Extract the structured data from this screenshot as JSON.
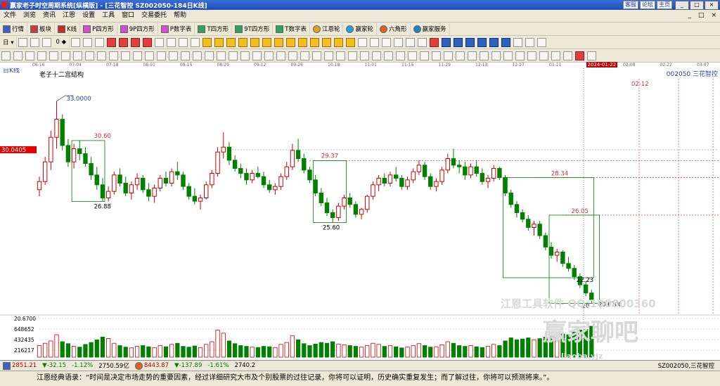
{
  "window": {
    "title": "赢家老子时空周期系统[纵横版] - [三花智控   SZ002050-184日K线]",
    "links": [
      "客服",
      "论坛",
      "主页"
    ],
    "controls": [
      "_",
      "□",
      "×"
    ],
    "mdi_controls": [
      "_",
      "□",
      "×"
    ]
  },
  "menu": [
    "文件",
    "浏览",
    "资讯",
    "江恩",
    "设置",
    "工具",
    "窗口",
    "交易委托",
    "帮助"
  ],
  "toolbar1": [
    "行情",
    "板块",
    "K线",
    "P四方形",
    "9P四方形",
    "P数字表",
    "T四方形",
    "9T四方形",
    "T数字表",
    "江恩轮",
    "赢家轮",
    "六角形",
    "赢家服务"
  ],
  "toolbar2_zoom": "0",
  "chart_data": {
    "type": "candlestick",
    "title": "日K线",
    "label": "老子十二宫结构",
    "security": "002050 三花智控",
    "date_ticks": [
      "06-16",
      "07-04",
      "07-18",
      "08-01",
      "08-15",
      "08-29",
      "09-12",
      "09-26",
      "10-18",
      "11-01",
      "11-15",
      "11-29",
      "12-13",
      "12-27",
      "01-11",
      "2024-01-22",
      "02-08",
      "02-22",
      "03-07"
    ],
    "selected_date": "2024-01-22",
    "projection_date": "02-12",
    "price_range": [
      20.67,
      33.0
    ],
    "current_price_tag": "30.0405",
    "annotations": [
      "33.0000",
      "30.60",
      "26.88",
      "29.37",
      "25.60",
      "28.34",
      "26.05",
      "22.23",
      "20.6700",
      "20"
    ],
    "volume_axis": [
      "20.6700",
      "648652",
      "432435",
      "216217"
    ],
    "candles": [
      [
        27.6,
        28.4,
        27.2,
        28.1
      ],
      [
        28.1,
        29.6,
        27.9,
        29.3
      ],
      [
        29.3,
        31.2,
        28.8,
        30.8
      ],
      [
        30.8,
        33.0,
        30.1,
        31.9
      ],
      [
        31.9,
        32.2,
        30.0,
        30.3
      ],
      [
        30.3,
        30.7,
        29.0,
        29.3
      ],
      [
        29.3,
        30.4,
        28.9,
        30.1
      ],
      [
        30.1,
        30.6,
        29.4,
        29.8
      ],
      [
        29.8,
        30.2,
        29.0,
        29.2
      ],
      [
        29.2,
        29.6,
        28.2,
        28.5
      ],
      [
        28.5,
        29.0,
        27.6,
        27.9
      ],
      [
        27.9,
        28.3,
        26.9,
        27.1
      ],
      [
        27.1,
        27.8,
        26.88,
        27.5
      ],
      [
        27.5,
        28.7,
        27.3,
        28.5
      ],
      [
        28.5,
        28.9,
        27.8,
        28.0
      ],
      [
        28.0,
        28.4,
        27.2,
        27.4
      ],
      [
        27.4,
        28.1,
        27.0,
        27.9
      ],
      [
        27.9,
        28.6,
        27.6,
        28.3
      ],
      [
        28.3,
        28.5,
        27.4,
        27.6
      ],
      [
        27.6,
        28.0,
        26.9,
        27.2
      ],
      [
        27.2,
        27.9,
        26.8,
        27.7
      ],
      [
        27.7,
        28.5,
        27.5,
        28.3
      ],
      [
        28.3,
        28.7,
        27.8,
        28.0
      ],
      [
        28.0,
        28.9,
        27.8,
        28.7
      ],
      [
        28.7,
        29.3,
        28.2,
        28.5
      ],
      [
        28.5,
        28.7,
        27.6,
        27.8
      ],
      [
        27.8,
        28.0,
        27.0,
        27.2
      ],
      [
        27.2,
        27.7,
        26.7,
        26.9
      ],
      [
        26.9,
        27.3,
        26.4,
        27.1
      ],
      [
        27.1,
        28.1,
        27.0,
        27.9
      ],
      [
        27.9,
        28.8,
        27.7,
        28.6
      ],
      [
        28.6,
        30.2,
        28.4,
        29.9
      ],
      [
        29.9,
        31.1,
        29.5,
        30.2
      ],
      [
        30.2,
        30.5,
        29.1,
        29.4
      ],
      [
        29.4,
        29.7,
        28.7,
        28.9
      ],
      [
        28.9,
        29.2,
        28.3,
        28.6
      ],
      [
        28.6,
        28.9,
        27.9,
        28.2
      ],
      [
        28.2,
        28.8,
        28.0,
        28.6
      ],
      [
        28.6,
        29.0,
        28.3,
        28.4
      ],
      [
        28.4,
        28.7,
        27.7,
        27.9
      ],
      [
        27.9,
        28.2,
        27.4,
        27.6
      ],
      [
        27.6,
        28.0,
        27.3,
        27.8
      ],
      [
        27.8,
        28.6,
        27.6,
        28.4
      ],
      [
        28.4,
        29.3,
        28.2,
        29.0
      ],
      [
        29.0,
        30.4,
        28.8,
        30.0
      ],
      [
        30.0,
        30.7,
        29.3,
        29.5
      ],
      [
        29.5,
        29.8,
        28.6,
        28.8
      ],
      [
        28.8,
        29.0,
        28.0,
        28.2
      ],
      [
        28.2,
        28.5,
        27.2,
        27.4
      ],
      [
        27.4,
        27.7,
        26.6,
        26.8
      ],
      [
        26.8,
        27.1,
        26.0,
        26.2
      ],
      [
        26.2,
        26.4,
        25.6,
        25.9
      ],
      [
        25.9,
        26.8,
        25.7,
        26.6
      ],
      [
        26.6,
        27.3,
        26.4,
        27.1
      ],
      [
        27.1,
        27.4,
        26.5,
        26.7
      ],
      [
        26.7,
        26.9,
        25.9,
        26.1
      ],
      [
        26.1,
        26.5,
        25.8,
        26.4
      ],
      [
        26.4,
        27.3,
        26.2,
        27.2
      ],
      [
        27.2,
        28.1,
        27.0,
        27.9
      ],
      [
        27.9,
        28.5,
        27.5,
        28.3
      ],
      [
        28.3,
        28.6,
        27.8,
        28.0
      ],
      [
        28.0,
        28.7,
        27.8,
        28.5
      ],
      [
        28.5,
        29.0,
        28.1,
        28.3
      ],
      [
        28.3,
        28.5,
        27.6,
        27.8
      ],
      [
        27.8,
        28.4,
        27.6,
        28.2
      ],
      [
        28.2,
        28.9,
        28.0,
        28.7
      ],
      [
        28.7,
        29.4,
        28.5,
        29.1
      ],
      [
        29.1,
        29.3,
        28.2,
        28.4
      ],
      [
        28.4,
        28.6,
        27.6,
        27.8
      ],
      [
        27.8,
        28.3,
        27.5,
        28.1
      ],
      [
        28.1,
        29.0,
        27.9,
        28.8
      ],
      [
        28.8,
        29.8,
        28.6,
        29.5
      ],
      [
        29.5,
        30.1,
        28.9,
        29.1
      ],
      [
        29.1,
        29.4,
        28.6,
        29.0
      ],
      [
        29.0,
        29.3,
        28.2,
        28.5
      ],
      [
        28.5,
        29.2,
        28.3,
        29.0
      ],
      [
        29.0,
        29.4,
        28.4,
        28.6
      ],
      [
        28.6,
        28.9,
        27.9,
        28.1
      ],
      [
        28.1,
        28.5,
        27.7,
        28.3
      ],
      [
        28.3,
        29.1,
        28.1,
        28.9
      ],
      [
        28.9,
        29.0,
        28.2,
        28.34
      ],
      [
        28.34,
        28.5,
        27.2,
        27.4
      ],
      [
        27.4,
        27.6,
        26.5,
        26.7
      ],
      [
        26.7,
        26.9,
        25.9,
        26.2
      ],
      [
        26.2,
        26.4,
        25.6,
        25.8
      ],
      [
        25.8,
        26.05,
        25.1,
        25.3
      ],
      [
        25.3,
        25.7,
        24.8,
        25.5
      ],
      [
        25.5,
        25.7,
        24.6,
        24.8
      ],
      [
        24.8,
        25.0,
        23.9,
        24.1
      ],
      [
        24.1,
        24.4,
        23.4,
        23.6
      ],
      [
        23.6,
        24.0,
        23.2,
        23.8
      ],
      [
        23.8,
        23.9,
        22.9,
        23.1
      ],
      [
        23.1,
        23.5,
        22.6,
        22.8
      ],
      [
        22.8,
        23.0,
        22.1,
        22.3
      ],
      [
        22.3,
        22.5,
        21.6,
        21.8
      ],
      [
        21.8,
        22.0,
        21.1,
        21.3
      ],
      [
        21.3,
        21.5,
        20.67,
        20.9
      ]
    ],
    "volume": [
      0.3,
      0.36,
      0.42,
      0.58,
      0.4,
      0.35,
      0.28,
      0.26,
      0.33,
      0.38,
      0.45,
      0.52,
      0.48,
      0.36,
      0.3,
      0.26,
      0.24,
      0.28,
      0.3,
      0.27,
      0.25,
      0.3,
      0.27,
      0.33,
      0.36,
      0.28,
      0.26,
      0.29,
      0.25,
      0.33,
      0.4,
      0.7,
      0.62,
      0.42,
      0.35,
      0.3,
      0.28,
      0.26,
      0.25,
      0.28,
      0.27,
      0.25,
      0.33,
      0.38,
      0.55,
      0.45,
      0.35,
      0.3,
      0.34,
      0.38,
      0.36,
      0.4,
      0.34,
      0.32,
      0.3,
      0.28,
      0.26,
      0.3,
      0.36,
      0.33,
      0.28,
      0.3,
      0.27,
      0.24,
      0.26,
      0.3,
      0.35,
      0.3,
      0.26,
      0.27,
      0.32,
      0.4,
      0.36,
      0.3,
      0.28,
      0.3,
      0.27,
      0.25,
      0.28,
      0.33,
      0.3,
      0.42,
      0.5,
      0.45,
      0.47,
      0.5,
      0.45,
      0.48,
      0.52,
      0.55,
      0.5,
      0.6,
      0.58,
      0.65,
      0.7,
      0.72,
      0.8
    ]
  },
  "bottom_bar": {
    "idx1_value": "2851.21",
    "idx1_change": "▼-32.15",
    "idx1_pct": "-1.12%",
    "idx1_amount": "2750.59亿",
    "idx2_value": "8443.87",
    "idx2_change": "▼-137.89",
    "idx2_pct": "-1.61%",
    "idx2_amount": "2740.2",
    "security": "SZ002050,三花智控"
  },
  "quote": "江恩经典语录：“时间是决定市场走势的重要因素，经过详细研究大市及个别股票的过往记录，你将可以证明，历史确实重复发生；而了解过往，你将可以预测将来。”。",
  "watermark": {
    "line1": "江恩工具软件 QQ:100800360",
    "line2": "赢家聊吧",
    "line3": "liaoba.yjz"
  },
  "colors": {
    "up": "#d00000",
    "down": "#008000",
    "box": "#008000",
    "level": "#e03030"
  }
}
